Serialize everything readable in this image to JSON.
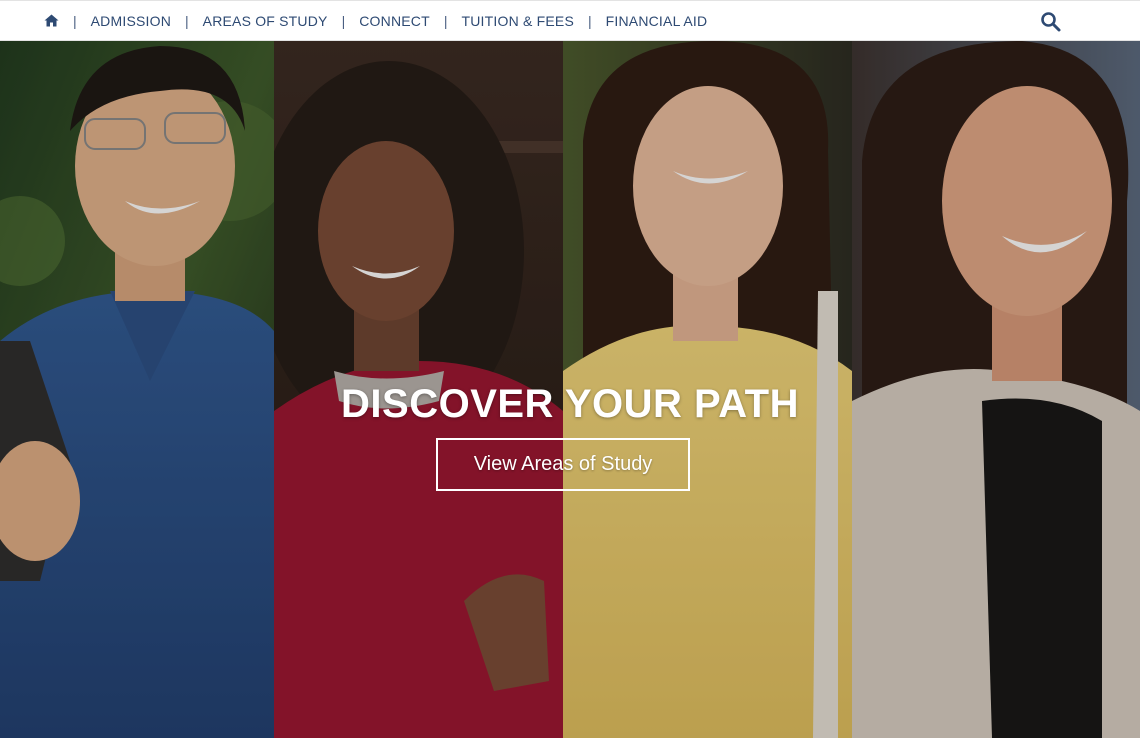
{
  "nav": {
    "home_icon": "home-icon",
    "items": [
      {
        "label": "ADMISSION"
      },
      {
        "label": "AREAS OF STUDY"
      },
      {
        "label": "CONNECT"
      },
      {
        "label": "TUITION & FEES"
      },
      {
        "label": "FINANCIAL AID"
      }
    ],
    "separator": "|",
    "search_icon": "search-icon"
  },
  "hero": {
    "headline": "DISCOVER YOUR PATH",
    "cta_label": "View Areas of Study"
  },
  "colors": {
    "nav_text": "#2e4a73",
    "cta_border": "#ffffff"
  }
}
